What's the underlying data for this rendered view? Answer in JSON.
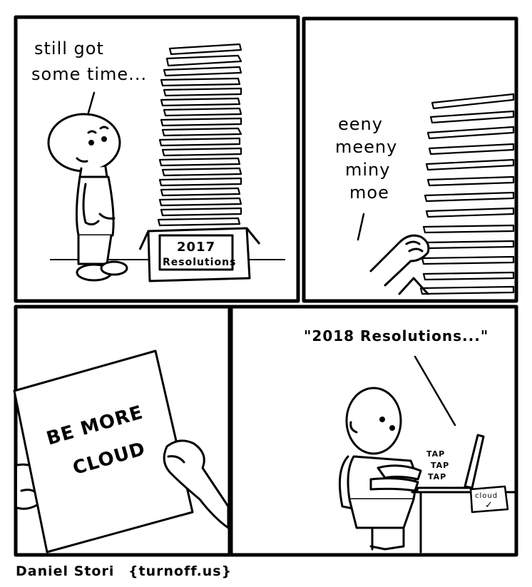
{
  "panels": {
    "panel1": {
      "speech": [
        "still got",
        "some time..."
      ],
      "box_label": [
        "2017",
        "Resolutions"
      ]
    },
    "panel2": {
      "speech": [
        "eeny",
        "meeny",
        "miny",
        "moe"
      ]
    },
    "panel3": {
      "paper_text": [
        "BE MORE",
        "CLOUD"
      ]
    },
    "panel4": {
      "speech": "\"2018 Resolutions...\"",
      "sound_effect": [
        "TAP",
        "TAP",
        "TAP"
      ],
      "note_text": "cloud",
      "note_mark": "✓"
    }
  },
  "credit": {
    "author": "Daniel Stori",
    "site": "{turnoff.us}"
  }
}
